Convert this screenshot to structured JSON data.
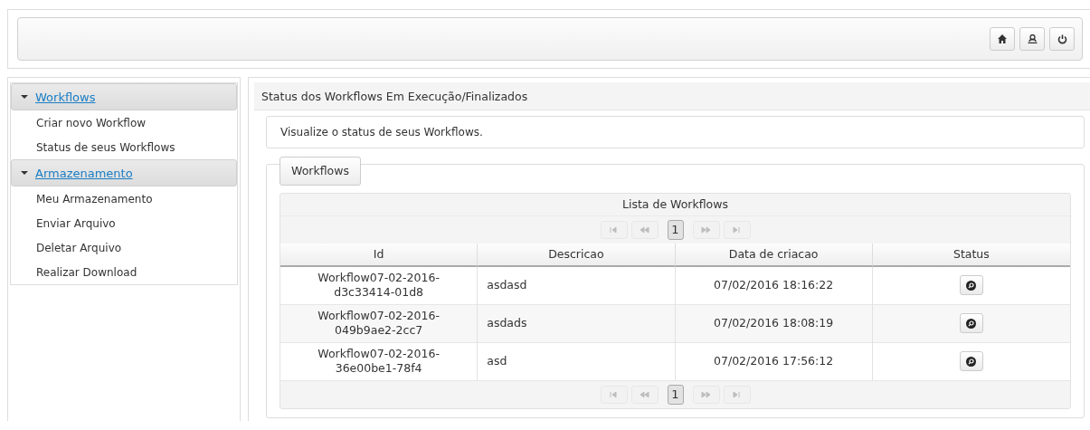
{
  "header": {
    "buttons": [
      {
        "kind": "home"
      },
      {
        "kind": "user"
      },
      {
        "kind": "power"
      }
    ]
  },
  "sidebar": {
    "sections": [
      {
        "title": "Workflows",
        "expanded": true,
        "items": [
          "Criar novo Workflow",
          "Status de seus Workflows"
        ]
      },
      {
        "title": "Armazenamento",
        "expanded": true,
        "items": [
          "Meu Armazenamento",
          "Enviar Arquivo",
          "Deletar Arquivo",
          "Realizar Download"
        ]
      }
    ]
  },
  "main": {
    "title": "Status dos Workflows Em Execução/Finalizados",
    "message": "Visualize o status de seus Workflows.",
    "fieldset_legend": "Workflows",
    "table": {
      "caption": "Lista de Workflows",
      "paginator": {
        "pages": [
          {
            "label": "1",
            "selected": true
          }
        ]
      },
      "columns": [
        "Id",
        "Descricao",
        "Data de criacao",
        "Status"
      ],
      "rows": [
        {
          "id": "Workflow07-02-2016-\nd3c33414-01d8",
          "description": "asdasd",
          "created": "07/02/2016 18:16:22"
        },
        {
          "id": "Workflow07-02-2016-\n049b9ae2-2cc7",
          "description": "asdads",
          "created": "07/02/2016 18:08:19"
        },
        {
          "id": "Workflow07-02-2016-\n36e00be1-78f4",
          "description": "asd",
          "created": "07/02/2016 17:56:12"
        }
      ],
      "bottom_paginator": {
        "pages": [
          {
            "label": "1",
            "selected": true
          }
        ]
      }
    }
  }
}
